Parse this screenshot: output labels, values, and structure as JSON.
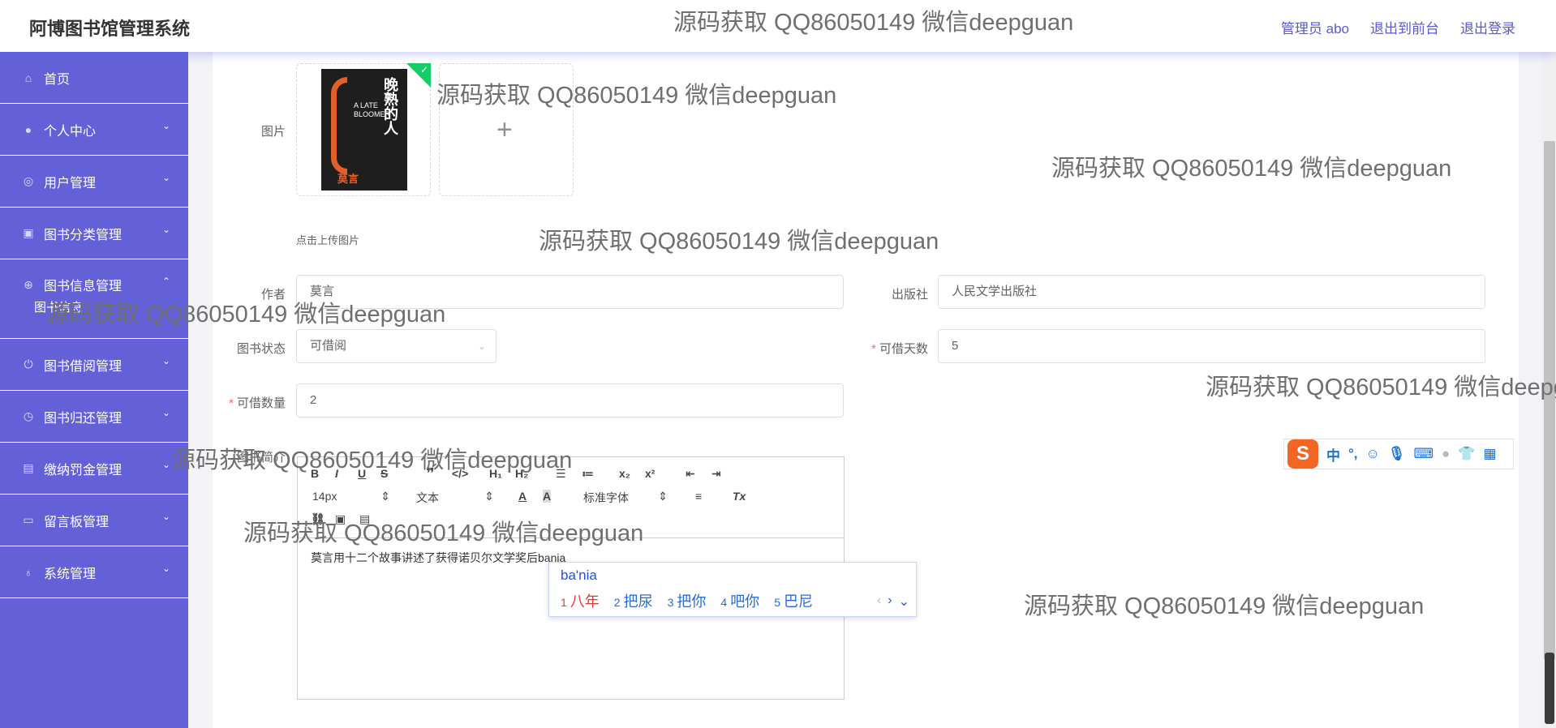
{
  "header": {
    "title": "阿博图书馆管理系统",
    "admin_label": "管理员 abo",
    "back_label": "退出到前台",
    "logout_label": "退出登录"
  },
  "sidebar": {
    "items": [
      {
        "label": "首页",
        "icon": "home-icon"
      },
      {
        "label": "个人中心",
        "icon": "user-icon"
      },
      {
        "label": "用户管理",
        "icon": "users-icon"
      },
      {
        "label": "图书分类管理",
        "icon": "category-icon"
      },
      {
        "label": "图书信息管理",
        "icon": "book-icon"
      },
      {
        "label": "图书借阅管理",
        "icon": "power-icon"
      },
      {
        "label": "图书归还管理",
        "icon": "compass-icon"
      },
      {
        "label": "缴纳罚金管理",
        "icon": "wallet-icon"
      },
      {
        "label": "留言板管理",
        "icon": "message-icon"
      },
      {
        "label": "系统管理",
        "icon": "mic-icon"
      }
    ],
    "sub_item": "图书信息"
  },
  "form": {
    "image_label": "图片",
    "upload_hint": "点击上传图片",
    "book_title": "晚熟的人",
    "book_en": "A LATE BLOOMER",
    "book_author": "莫言",
    "author_label": "作者",
    "author_value": "莫言",
    "publisher_label": "出版社",
    "publisher_value": "人民文学出版社",
    "status_label": "图书状态",
    "status_value": "可借阅",
    "days_label": "可借天数",
    "days_value": "5",
    "qty_label": "可借数量",
    "qty_value": "2",
    "intro_label": "图书简介"
  },
  "editor": {
    "size": "14px",
    "block": "文本",
    "font": "标准字体",
    "content": "莫言用十二个故事讲述了获得诺贝尔文学奖后bania"
  },
  "ime": {
    "input": "ba'nia",
    "candidates": [
      {
        "n": "1",
        "c": "八年"
      },
      {
        "n": "2",
        "c": "把尿"
      },
      {
        "n": "3",
        "c": "把你"
      },
      {
        "n": "4",
        "c": "吧你"
      },
      {
        "n": "5",
        "c": "巴尼"
      }
    ],
    "bar_mode": "中",
    "bar_punct": "°,"
  },
  "watermark": "源码获取 QQ86050149 微信deepguan"
}
